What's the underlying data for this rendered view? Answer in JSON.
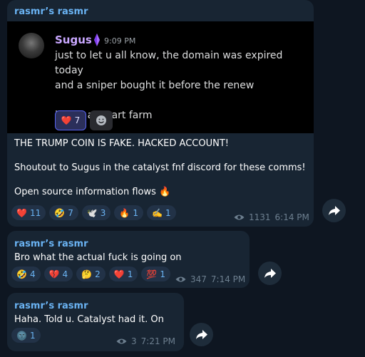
{
  "messages": [
    {
      "sender": "rasmr’s rasmr",
      "embed": {
        "name": "Sugus",
        "time": "9:09 PM",
        "text": "just to let u all know, the domain was expired today\nand a sniper bought it before the renew\n\nis just a smart farm",
        "reaction_emoji": "❤️",
        "reaction_count": "7"
      },
      "text": "THE TRUMP COIN IS FAKE. HACKED ACCOUNT!\n\nShoutout to Sugus in the catalyst fnf discord for these comms!\n\nOpen source information flows 🔥",
      "reactions": [
        {
          "emoji": "❤️",
          "count": "11"
        },
        {
          "emoji": "🤣",
          "count": "7"
        },
        {
          "emoji": "🕊️",
          "count": "3"
        },
        {
          "emoji": "🔥",
          "count": "1"
        },
        {
          "emoji": "✍️",
          "count": "1"
        }
      ],
      "views": "1131",
      "time": "6:14 PM"
    },
    {
      "sender": "rasmr’s rasmr",
      "text": "Bro what the actual fuck is going on",
      "reactions": [
        {
          "emoji": "🤣",
          "count": "4"
        },
        {
          "emoji": "💔",
          "count": "4"
        },
        {
          "emoji": "🤔",
          "count": "2"
        },
        {
          "emoji": "❤️",
          "count": "1"
        },
        {
          "emoji": "💯",
          "count": "1"
        }
      ],
      "views": "347",
      "time": "7:14 PM"
    },
    {
      "sender": "rasmr’s rasmr",
      "text": "Haha. Told u. Catalyst had it. On gang",
      "reactions": [
        {
          "emoji": "🌚",
          "count": "1"
        }
      ],
      "views": "3",
      "time": "7:21 PM"
    }
  ],
  "icons": {
    "views": "eye-icon",
    "share": "share-arrow-icon",
    "badge": "amethyst-badge-icon",
    "add_reaction": "add-reaction-smiley-icon"
  },
  "colors": {
    "background": "#0e1621",
    "bubble": "#182533",
    "sender": "#6ab3f3",
    "reaction_bg": "#223247",
    "meta": "#6d7f8f",
    "embed_name": "#c9a7ff"
  }
}
